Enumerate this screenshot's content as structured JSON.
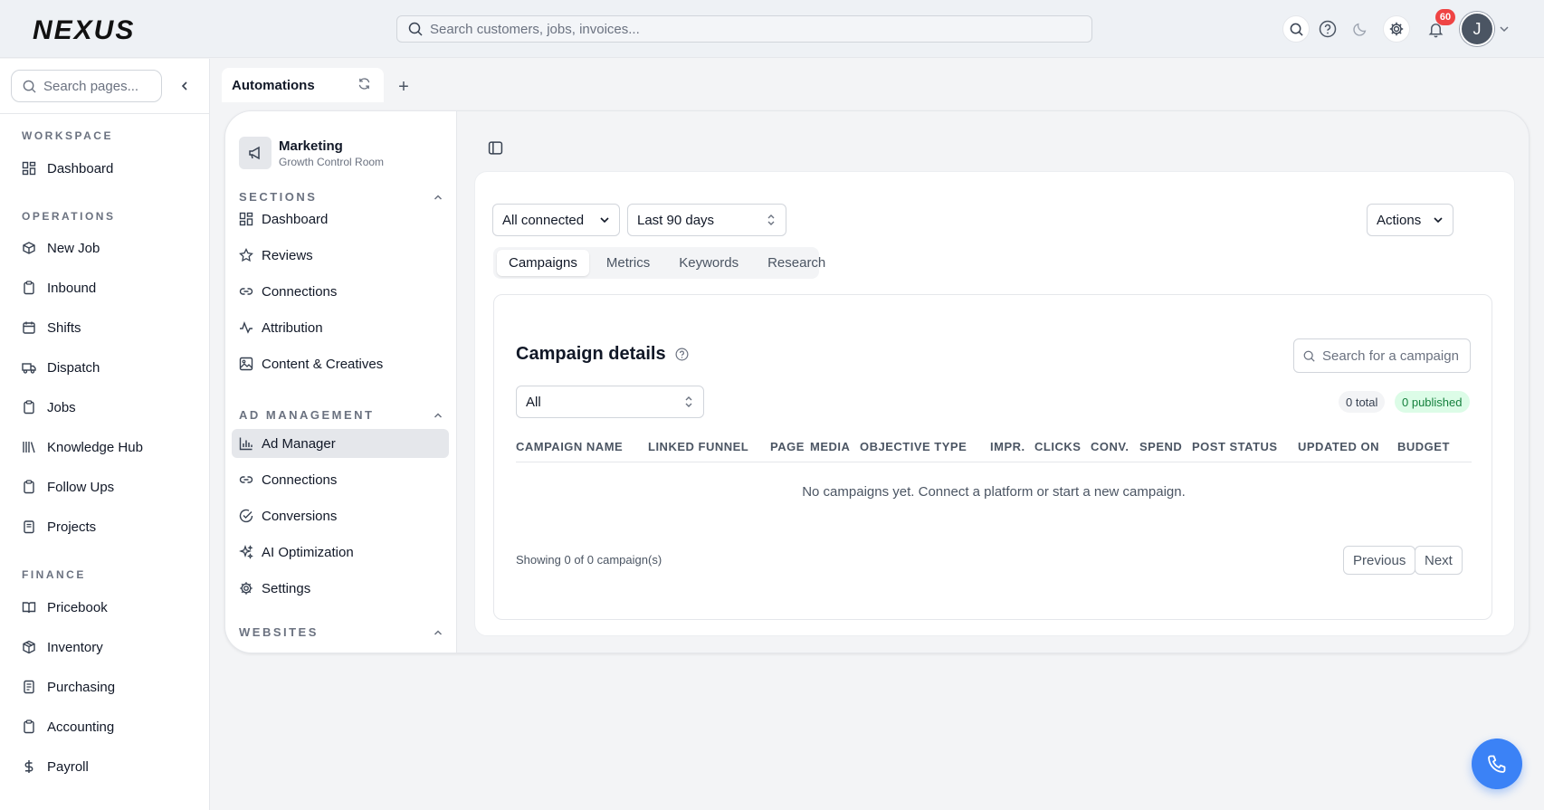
{
  "header": {
    "logo_text": "NEXUS",
    "search_placeholder": "Search customers, jobs, invoices...",
    "notifications_count": "60",
    "avatar_initial": "J"
  },
  "sidebar": {
    "search_placeholder": "Search pages...",
    "sections": [
      {
        "title": "WORKSPACE",
        "items": [
          {
            "label": "Dashboard",
            "icon": "dashboard-icon"
          }
        ]
      },
      {
        "title": "OPERATIONS",
        "items": [
          {
            "label": "New Job",
            "icon": "new-job-icon"
          },
          {
            "label": "Inbound",
            "icon": "clipboard-icon"
          },
          {
            "label": "Shifts",
            "icon": "calendar-icon"
          },
          {
            "label": "Dispatch",
            "icon": "truck-icon"
          },
          {
            "label": "Jobs",
            "icon": "clipboard-icon"
          },
          {
            "label": "Knowledge Hub",
            "icon": "library-icon"
          },
          {
            "label": "Follow Ups",
            "icon": "clipboard-icon"
          },
          {
            "label": "Projects",
            "icon": "folder-icon"
          }
        ]
      },
      {
        "title": "FINANCE",
        "items": [
          {
            "label": "Pricebook",
            "icon": "book-icon"
          },
          {
            "label": "Inventory",
            "icon": "package-icon"
          },
          {
            "label": "Purchasing",
            "icon": "receipt-icon"
          },
          {
            "label": "Accounting",
            "icon": "clipboard-icon"
          },
          {
            "label": "Payroll",
            "icon": "dollar-icon"
          }
        ]
      }
    ]
  },
  "tabs": {
    "active_label": "Automations"
  },
  "inner_nav": {
    "org_name": "Marketing",
    "org_sub": "Growth Control Room",
    "sections": [
      {
        "title": "SECTIONS",
        "items": [
          {
            "label": "Dashboard",
            "icon": "dashboard-icon"
          },
          {
            "label": "Reviews",
            "icon": "star-icon"
          },
          {
            "label": "Connections",
            "icon": "link-icon"
          },
          {
            "label": "Attribution",
            "icon": "activity-icon"
          },
          {
            "label": "Content & Creatives",
            "icon": "image-icon"
          }
        ]
      },
      {
        "title": "AD MANAGEMENT",
        "items": [
          {
            "label": "Ad Manager",
            "icon": "bar-chart-icon",
            "active": true
          },
          {
            "label": "Connections",
            "icon": "link-icon"
          },
          {
            "label": "Conversions",
            "icon": "check-circle-icon"
          },
          {
            "label": "AI Optimization",
            "icon": "sparkles-icon"
          },
          {
            "label": "Settings",
            "icon": "gear-icon"
          }
        ]
      },
      {
        "title": "WEBSITES",
        "items": []
      }
    ]
  },
  "toolbar": {
    "connection_filter": "All connected",
    "date_range": "Last 90 days",
    "actions_label": "Actions"
  },
  "content_tabs": [
    "Campaigns",
    "Metrics",
    "Keywords",
    "Research"
  ],
  "campaigns": {
    "title": "Campaign details",
    "search_placeholder": "Search for a campaign",
    "status_filter": "All",
    "total_label": "0 total",
    "published_label": "0 published",
    "columns": [
      "CAMPAIGN NAME",
      "LINKED FUNNEL",
      "PAGE",
      "MEDIA",
      "OBJECTIVE TYPE",
      "IMPR.",
      "CLICKS",
      "CONV.",
      "SPEND",
      "POST STATUS",
      "UPDATED ON",
      "BUDGET"
    ],
    "empty_message": "No campaigns yet. Connect a platform or start a new campaign.",
    "showing_text": "Showing 0 of 0 campaign(s)",
    "prev_label": "Previous",
    "next_label": "Next"
  },
  "colors": {
    "accent": "#3b82f6",
    "badge": "#ef4444",
    "published_bg": "#dcfce7",
    "published_text": "#15803d"
  }
}
